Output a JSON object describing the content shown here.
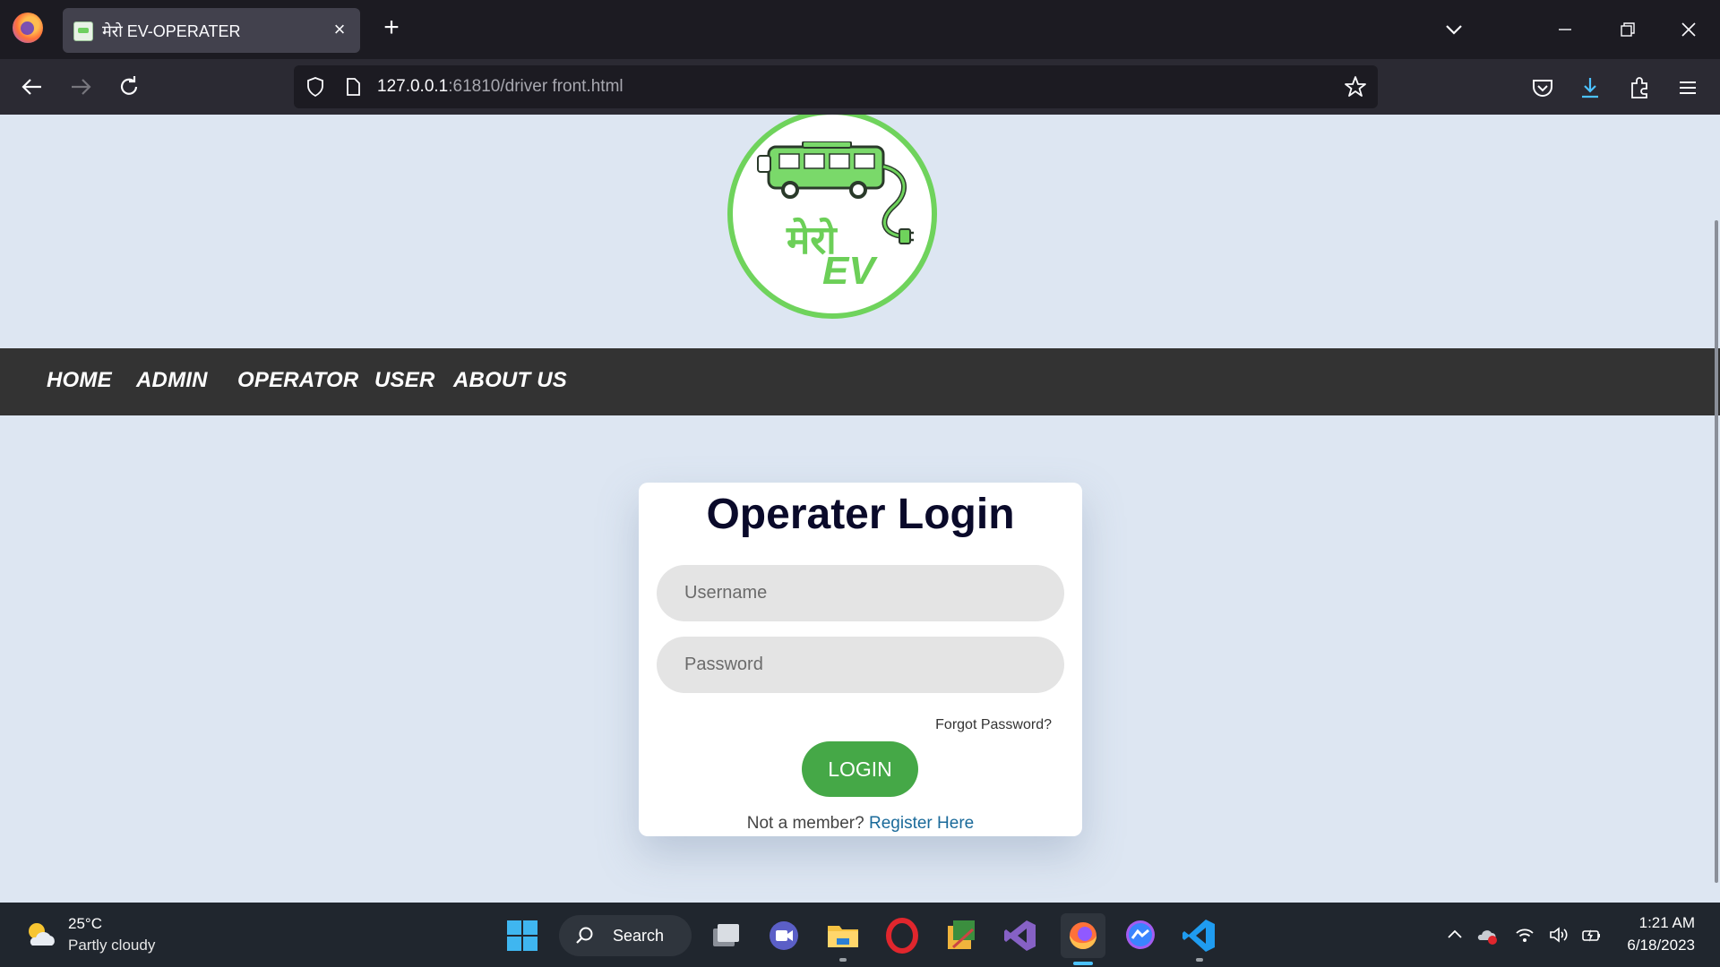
{
  "browser": {
    "tab_title": "मेरो EV-OPERATER",
    "tab_close": "×",
    "new_tab": "+",
    "url_host": "127.0.0.1",
    "url_rest": ":61810/driver front.html"
  },
  "logo": {
    "text_primary": "मेरो",
    "text_secondary": "EV",
    "accent_color": "#6fd35c"
  },
  "site_nav": {
    "items": [
      "HOME",
      "ADMIN",
      "OPERATOR",
      "USER",
      "ABOUT US"
    ]
  },
  "login_card": {
    "title": "Operater Login",
    "username_placeholder": "Username",
    "password_placeholder": "Password",
    "forgot_password": "Forgot Password?",
    "login_button": "LOGIN",
    "member_prompt": "Not a member?",
    "register_link": "Register Here",
    "button_color": "#45a847"
  },
  "taskbar": {
    "weather_temp": "25°C",
    "weather_desc": "Partly cloudy",
    "search_label": "Search",
    "time": "1:21 AM",
    "date": "6/18/2023",
    "apps": [
      "task-view",
      "meet-chat",
      "file-explorer",
      "opera",
      "paint-tool",
      "visual-studio",
      "firefox",
      "messenger",
      "vscode"
    ]
  }
}
